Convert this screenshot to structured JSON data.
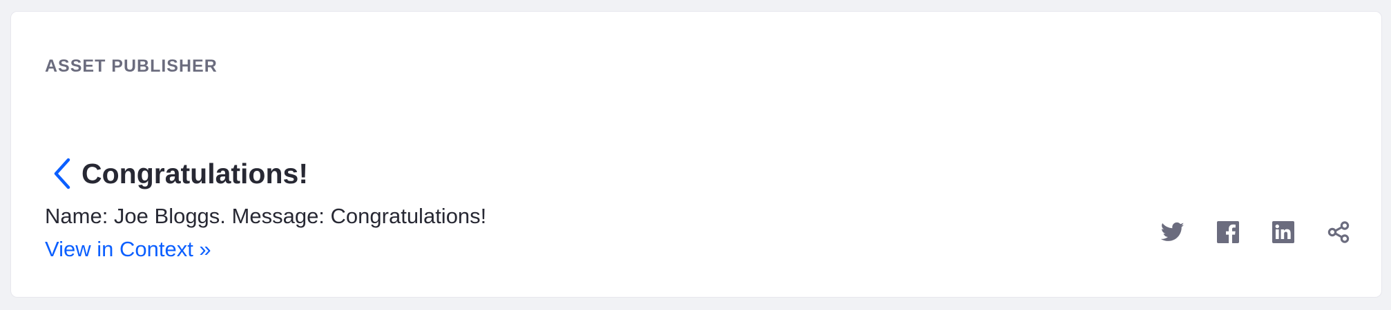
{
  "portlet": {
    "title": "ASSET PUBLISHER"
  },
  "asset": {
    "back_icon": "chevron-left-icon",
    "title": "Congratulations!",
    "summary": "Name: Joe Bloggs. Message: Congratulations!",
    "view_link": "View in Context »"
  },
  "social": {
    "buttons": [
      {
        "icon": "twitter-icon"
      },
      {
        "icon": "facebook-icon"
      },
      {
        "icon": "linkedin-icon"
      },
      {
        "icon": "share-icon"
      }
    ]
  },
  "colors": {
    "background": "#f1f2f5",
    "card": "#ffffff",
    "title_muted": "#6b6c7e",
    "text": "#272833",
    "link": "#0b5fff",
    "icon": "#6b6c7e"
  }
}
